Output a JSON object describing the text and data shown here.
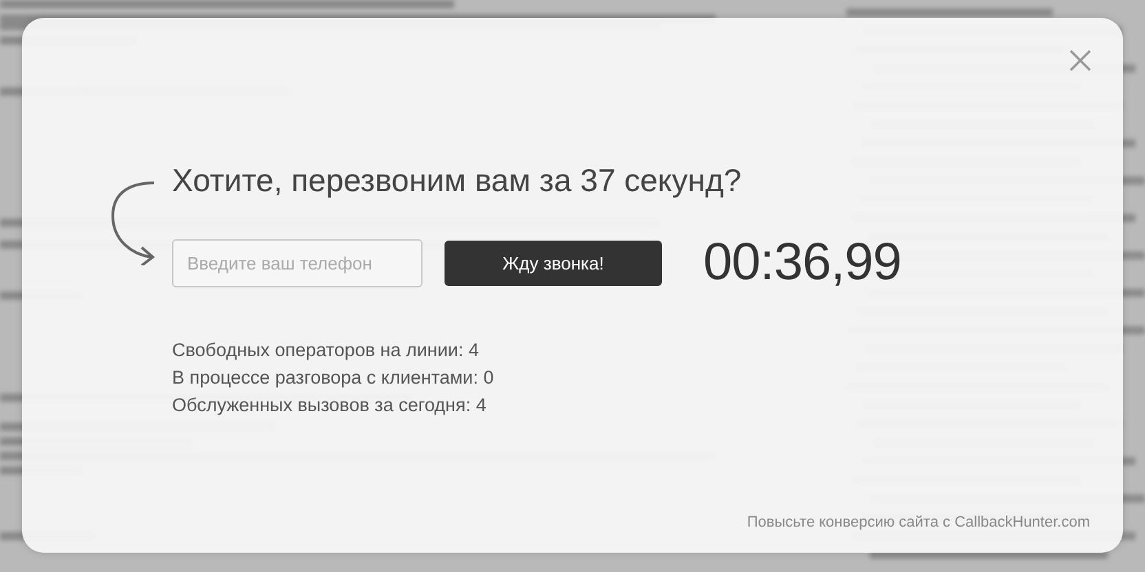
{
  "dialog": {
    "headline": "Хотите, перезвоним вам за 37 секунд?",
    "phone_field": {
      "placeholder": "Введите ваш телефон"
    },
    "submit_button": "Жду звонка!",
    "timer": "00:36,99",
    "stats": [
      "Свободных операторов на линии: 4",
      "В процессе разговора с клиентами: 0",
      "Обслуженных вызовов за сегодня: 4"
    ],
    "footer_text": "Повысьте конверсию сайта с CallbackHunter.com"
  }
}
